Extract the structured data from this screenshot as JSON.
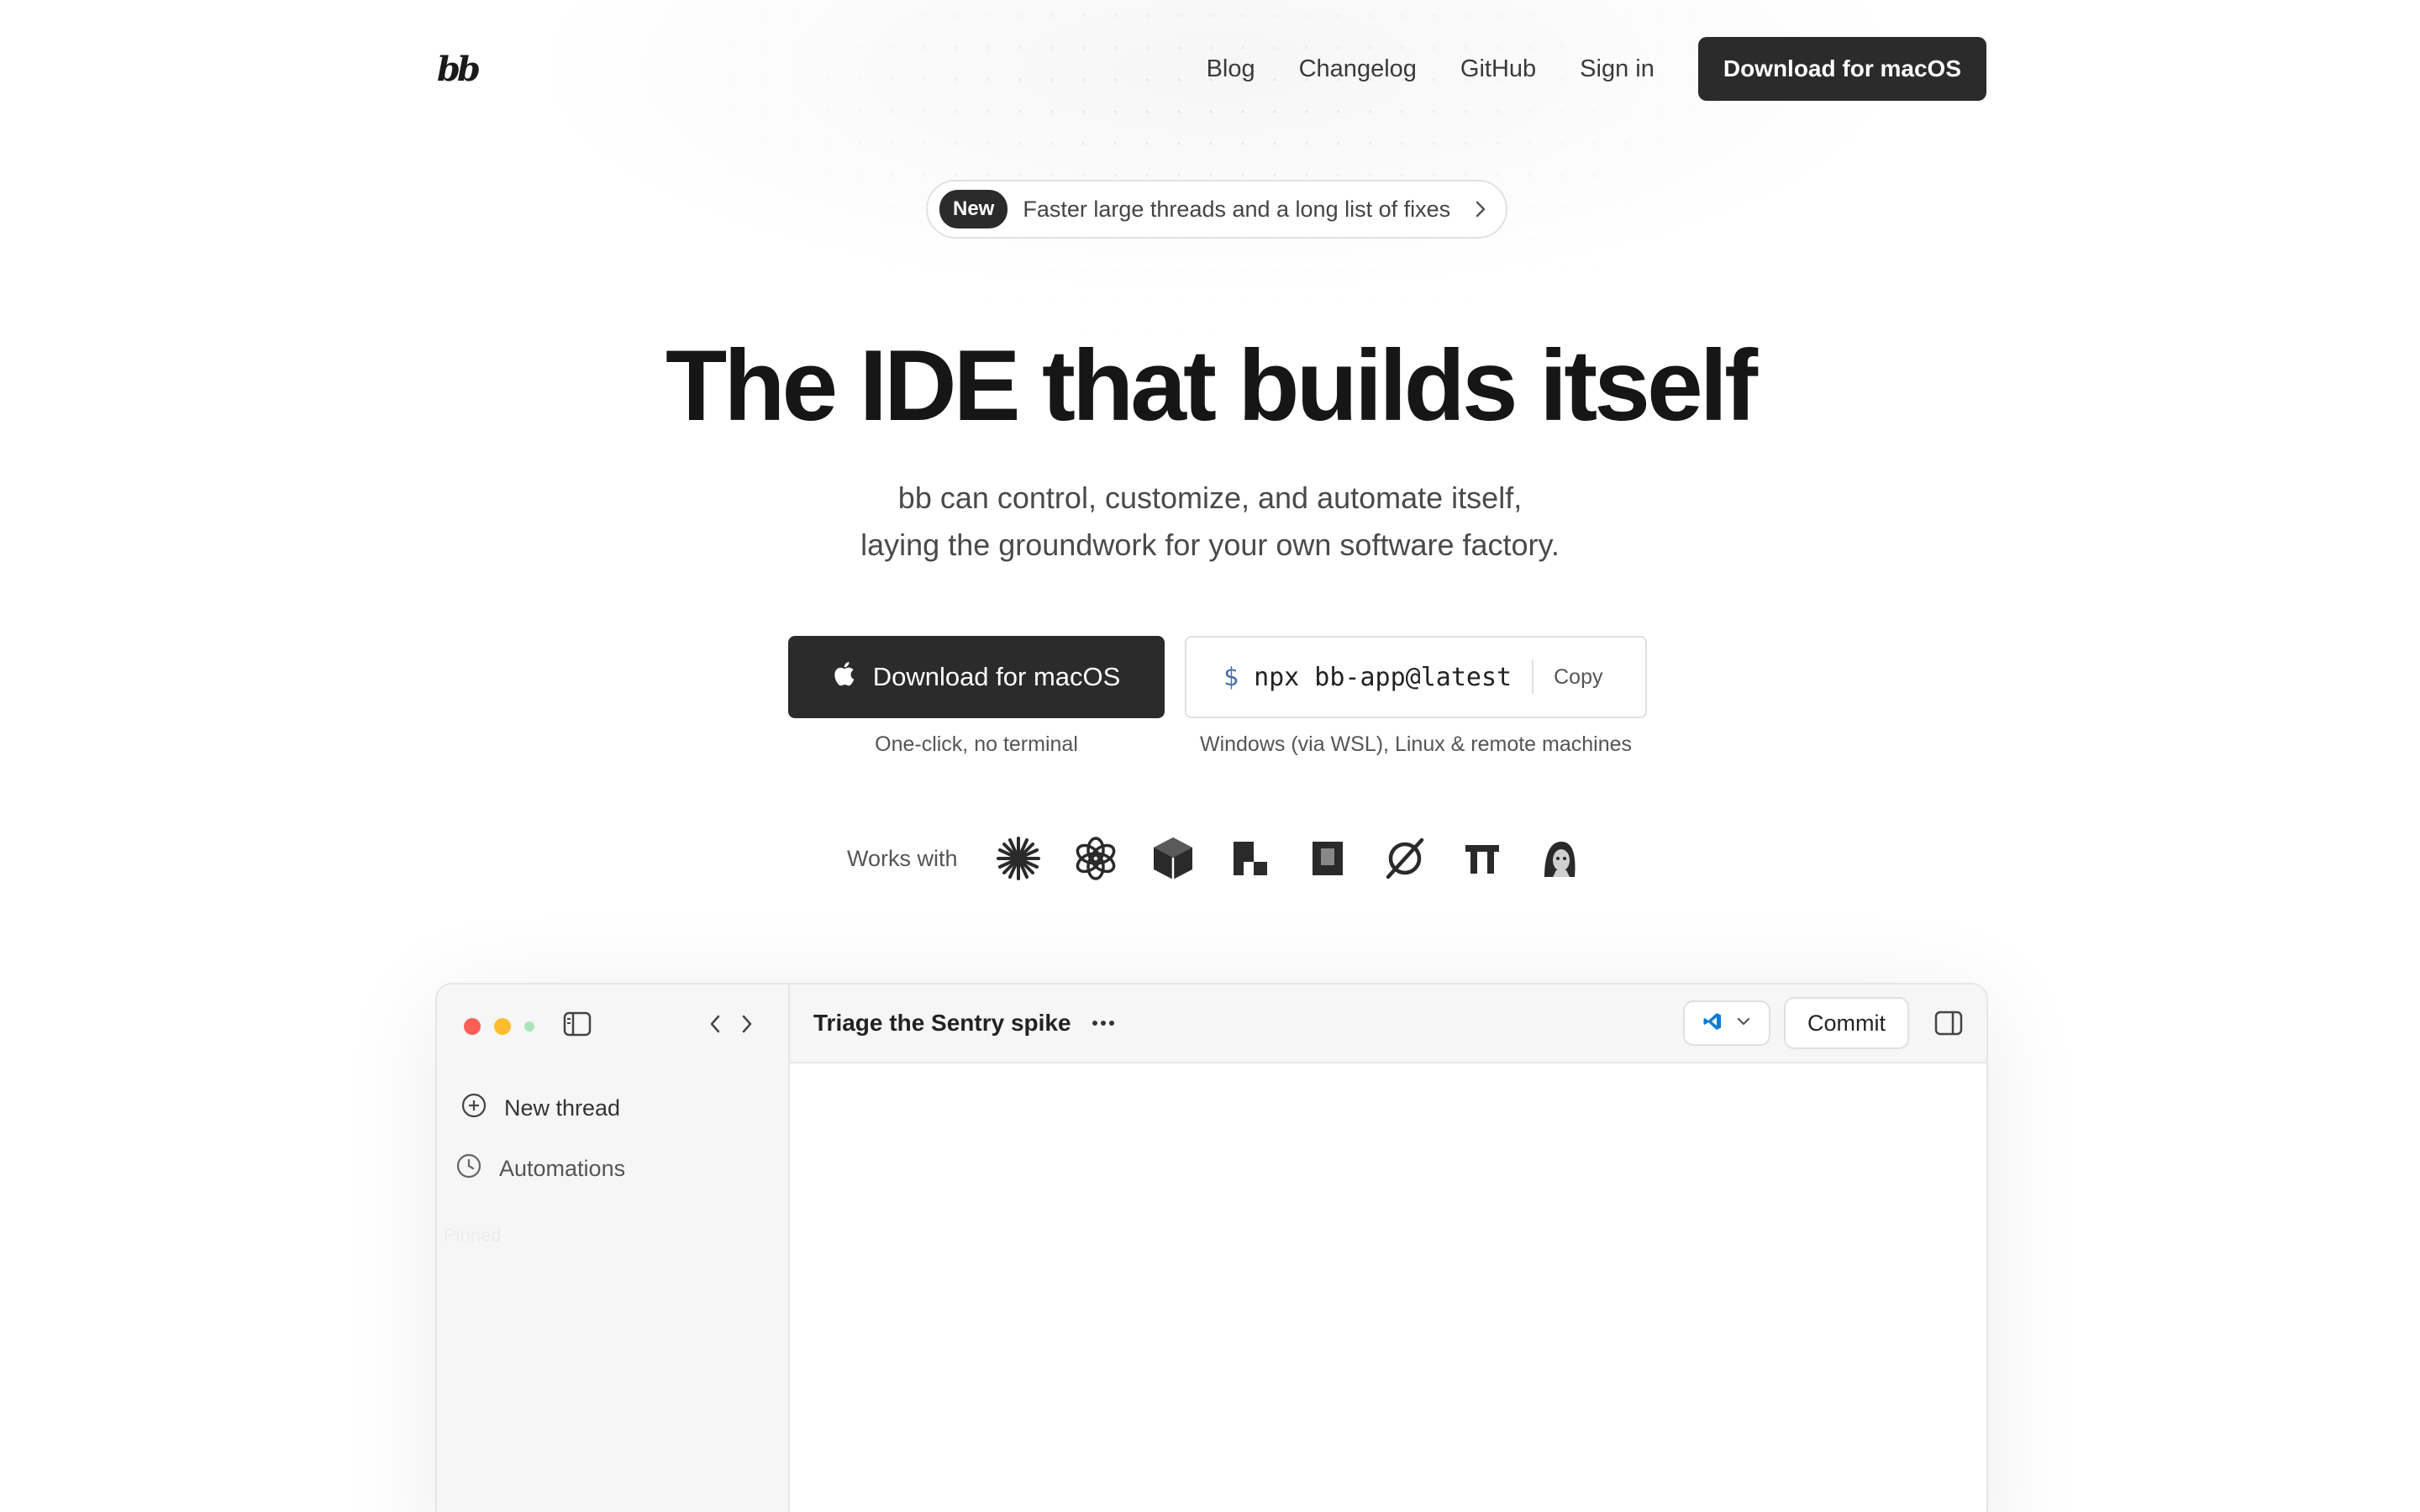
{
  "nav": {
    "logo": "bb",
    "links": [
      "Blog",
      "Changelog",
      "GitHub",
      "Sign in"
    ],
    "cta": "Download for macOS"
  },
  "badge": {
    "tag": "New",
    "text": "Faster large threads and a long list of fixes"
  },
  "hero": {
    "title": "The IDE that builds itself",
    "subtitle_line1": "bb can control, customize, and automate itself,",
    "subtitle_line2": "laying the groundwork for your own software factory."
  },
  "cta": {
    "download_label": "Download for macOS",
    "download_note": "One-click, no terminal",
    "npx_prompt": "$",
    "npx_command": "npx bb-app@latest",
    "copy_label": "Copy",
    "npx_note": "Windows (via WSL), Linux & remote machines"
  },
  "works_with": {
    "label": "Works with",
    "icons": [
      "claude-icon",
      "openai-icon",
      "cube-icon",
      "pixel-logo-icon",
      "square-logo-icon",
      "no-symbol-icon",
      "tt-logo-icon",
      "avatar-logo-icon"
    ]
  },
  "app": {
    "sidebar_items": [
      "New thread",
      "Automations"
    ],
    "pinned_label": "Pinned",
    "thread_title": "Triage the Sentry spike",
    "commit_label": "Commit",
    "traffic_colors": [
      "#ff5f57",
      "#febc2e",
      "#a8e6b8"
    ],
    "accent": "#0a7cd6"
  }
}
